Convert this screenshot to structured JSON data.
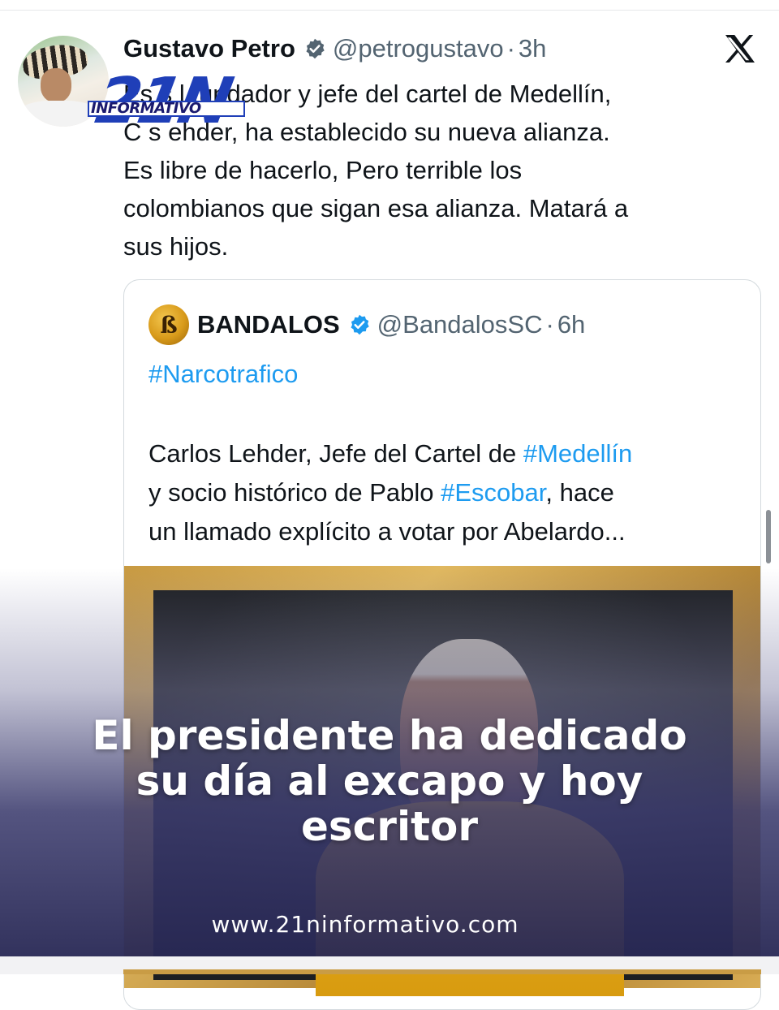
{
  "tweet": {
    "author_name": "Gustavo Petro",
    "handle": "@petrogustavo",
    "separator": "·",
    "time": "3h",
    "text": "Es     s  l fundador y jefe del cartel de Medellín,\nC     s   ehder, ha establecido su nueva alianza.\nEs libre de hacerlo, Pero terrible los\ncolombianos que sigan esa alianza. Matará a\nsus hijos.",
    "brand_icon": "x-logo-icon",
    "verified_color": "#536471"
  },
  "watermark": {
    "number": "21N",
    "word": "INFORMATIVO",
    "color": "#1f3fb8"
  },
  "quote": {
    "avatar_letter": "ß",
    "author_name": "BANDALOS",
    "handle": "@BandalosSC",
    "separator": "·",
    "time": "6h",
    "hashtag": "#Narcotrafico",
    "body_1": "Carlos Lehder, Jefe del Cartel de ",
    "link_medellin": "#Medellín",
    "body_2": "y socio histórico de Pablo ",
    "link_escobar": "#Escobar",
    "body_3": ", hace",
    "body_4": "un llamado explícito a votar por Abelardo...",
    "link_color": "#1d9bf0",
    "verified_color": "#1d9bf0"
  },
  "overlay": {
    "headline": "El presidente ha dedicado\nsu día al excapo y hoy\nescritor",
    "website": "www.21ninformativo.com"
  }
}
